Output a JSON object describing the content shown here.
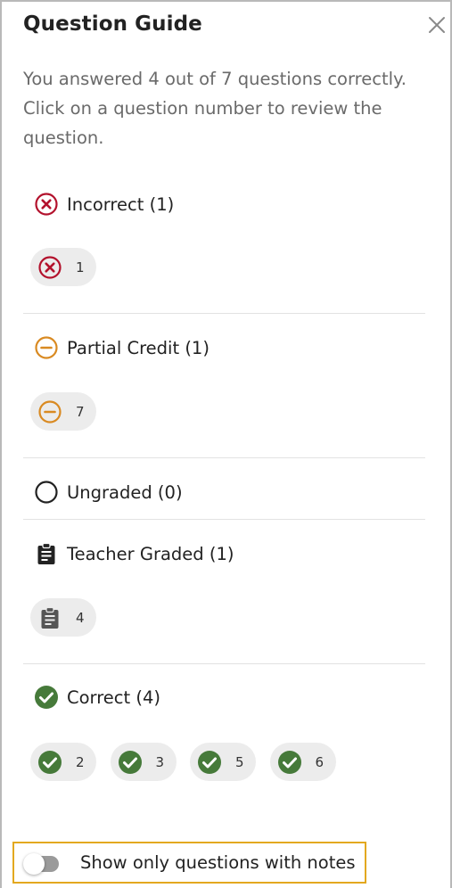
{
  "header": {
    "title": "Question Guide"
  },
  "description": "You answered 4 out of 7 questions correctly. Click on a question number to review the question.",
  "colors": {
    "incorrect": "#b3122d",
    "partial": "#d98a22",
    "ungraded": "#222222",
    "teacher": "#333333",
    "correct": "#467a3a",
    "highlight": "#e3a81f"
  },
  "sections": {
    "incorrect": {
      "label": "Incorrect (1)",
      "icon": "x-circle-icon",
      "items": [
        "1"
      ]
    },
    "partial": {
      "label": "Partial Credit (1)",
      "icon": "minus-circle-icon",
      "items": [
        "7"
      ]
    },
    "ungraded": {
      "label": "Ungraded (0)",
      "icon": "empty-circle-icon",
      "items": []
    },
    "teacher": {
      "label": "Teacher Graded (1)",
      "icon": "clipboard-icon",
      "items": [
        "4"
      ]
    },
    "correct": {
      "label": "Correct (4)",
      "icon": "check-circle-icon",
      "items": [
        "2",
        "3",
        "5",
        "6"
      ]
    }
  },
  "toggle": {
    "label": "Show only questions with notes",
    "checked": false
  }
}
